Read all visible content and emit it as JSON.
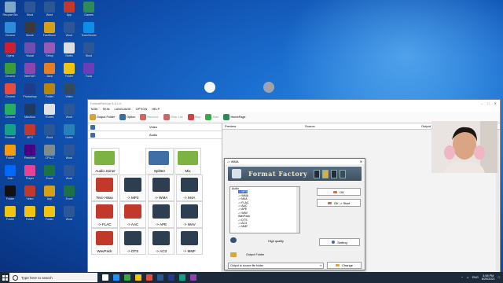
{
  "desktop_icons": [
    {
      "label": "Recycle Bin",
      "color": "#7fa7c9"
    },
    {
      "label": "Word",
      "color": "#2b5797"
    },
    {
      "label": "Word",
      "color": "#2b5797"
    },
    {
      "label": "App",
      "color": "#c0392b"
    },
    {
      "label": "Games",
      "color": "#2e8b57"
    },
    {
      "label": "Chrome",
      "color": "#2f8bd9"
    },
    {
      "label": "Movie",
      "color": "#3a3a3a"
    },
    {
      "label": "FastStone",
      "color": "#d4a017"
    },
    {
      "label": "Word",
      "color": "#2b5797"
    },
    {
      "label": "TeamViewer",
      "color": "#0e8ee9"
    },
    {
      "label": "Opera",
      "color": "#cc1f2f"
    },
    {
      "label": "Visual",
      "color": "#6e4fb0"
    },
    {
      "label": "Setup",
      "color": "#9b59b6"
    },
    {
      "label": "Notes",
      "color": "#dddddd"
    },
    {
      "label": "Word",
      "color": "#2b5797"
    },
    {
      "label": "Chrome",
      "color": "#3b9c3b"
    },
    {
      "label": "WinRAR",
      "color": "#8e44ad"
    },
    {
      "label": "Java",
      "color": "#e67e22"
    },
    {
      "label": "Folder",
      "color": "#f1c40f"
    },
    {
      "label": "Tools",
      "color": "#6a3fb5"
    },
    {
      "label": "Chrome",
      "color": "#e74c3c"
    },
    {
      "label": "Photoshop",
      "color": "#1f3c88"
    },
    {
      "label": "Folder",
      "color": "#b8860b"
    },
    {
      "label": "Video",
      "color": "#34495e"
    },
    {
      "label": "Chrome",
      "color": "#27ae60"
    },
    {
      "label": "Maxthon",
      "color": "#1f3a5f"
    },
    {
      "label": "iTunes",
      "color": "#e0e0e0"
    },
    {
      "label": "Word",
      "color": "#2b5797"
    },
    {
      "label": "Browser",
      "color": "#16a085"
    },
    {
      "label": "MP3",
      "color": "#c0392b"
    },
    {
      "label": "Word",
      "color": "#2b5797"
    },
    {
      "label": "Notes",
      "color": "#2980b9"
    },
    {
      "label": "Folder",
      "color": "#f39c12"
    },
    {
      "label": "Premiere",
      "color": "#4b0082"
    },
    {
      "label": "CPU-Z",
      "color": "#7f8c8d"
    },
    {
      "label": "Word",
      "color": "#2b5797"
    },
    {
      "label": "Zalo",
      "color": "#0068ff"
    },
    {
      "label": "Player",
      "color": "#e84393"
    },
    {
      "label": "Excel",
      "color": "#1e7145"
    },
    {
      "label": "Word",
      "color": "#2b5797"
    },
    {
      "label": "Folder",
      "color": "#111111"
    },
    {
      "label": "Video",
      "color": "#c0392b"
    },
    {
      "label": "App",
      "color": "#d4a017"
    },
    {
      "label": "Excel",
      "color": "#1e7145"
    },
    {
      "label": "Folder",
      "color": "#f1c40f"
    },
    {
      "label": "Folder",
      "color": "#f1c40f"
    },
    {
      "label": "Folder",
      "color": "#f1c40f"
    },
    {
      "label": "Word",
      "color": "#2b5797"
    }
  ],
  "floating_icons": [
    {
      "label": "",
      "color": "#f5f5f5"
    },
    {
      "label": "",
      "color": "#9aa5b0"
    }
  ],
  "ff_window": {
    "title": "FormatFactory 5.8.1.0",
    "menu": [
      "TASK",
      "SKIN",
      "LANGUAGE",
      "OPTION",
      "HELP"
    ],
    "toolbar": [
      {
        "label": "Output Folder",
        "color": "#d8a23a",
        "dim": false
      },
      {
        "label": "Option",
        "color": "#3a6ea5",
        "dim": false
      },
      {
        "label": "Remove",
        "color": "#c66",
        "dim": true
      },
      {
        "label": "Clear List",
        "color": "#c66",
        "dim": true
      },
      {
        "label": "Stop",
        "color": "#c44",
        "dim": true
      },
      {
        "label": "Start",
        "color": "#3aa845",
        "dim": true
      },
      {
        "label": "HomePage",
        "color": "#2e8b57",
        "dim": false
      }
    ],
    "categories": [
      "Video",
      "Audio"
    ],
    "tiles": [
      {
        "label": "Audio Joiner",
        "color": "#7cb342"
      },
      {
        "label": "Splitter",
        "color": "#3f6fa5"
      },
      {
        "label": "Mix",
        "color": "#7cb342"
      },
      {
        "label": "Text->Wav",
        "color": "#c0392b"
      },
      {
        "label": "-> MP3",
        "color": "#2c3e50"
      },
      {
        "label": "-> WMA",
        "color": "#2c3e50"
      },
      {
        "label": "-> M4A",
        "color": "#2c3e50"
      },
      {
        "label": "-> FLAC",
        "color": "#c0392b"
      },
      {
        "label": "-> AAC",
        "color": "#c0392b"
      },
      {
        "label": "-> APE",
        "color": "#2c3e50"
      },
      {
        "label": "-> WAV",
        "color": "#2c3e50"
      },
      {
        "label": "WavPack",
        "color": "#c0392b"
      },
      {
        "label": "-> DTS",
        "color": "#2c3e50"
      },
      {
        "label": "-> AC3",
        "color": "#2c3e50"
      },
      {
        "label": "-> MMF",
        "color": "#2c3e50"
      }
    ],
    "list_headers": {
      "preview": "Preview",
      "source": "Source",
      "output": "Output"
    }
  },
  "dialog": {
    "title": "-> WMA",
    "banner": "Format Factory",
    "tree": [
      {
        "label": "Audio",
        "sel": false
      },
      {
        "label": "-> MP3",
        "sel": true
      },
      {
        "label": "-> WMA",
        "sel": false
      },
      {
        "label": "-> M4A",
        "sel": false
      },
      {
        "label": "-> FLAC",
        "sel": false
      },
      {
        "label": "-> AAC",
        "sel": false
      },
      {
        "label": "-> APE",
        "sel": false
      },
      {
        "label": "-> WAV",
        "sel": false
      },
      {
        "label": "WavPack",
        "sel": false
      },
      {
        "label": "-> DTS",
        "sel": false
      },
      {
        "label": "-> AC3",
        "sel": false
      },
      {
        "label": "-> MMF",
        "sel": false
      }
    ],
    "ok": "OK",
    "ok_start": "OK -> Start",
    "high_quality": "High quality",
    "setting": "Setting",
    "output_folder": "Output Folder",
    "output_select": "Output to source file folder",
    "change": "Change"
  },
  "taskbar": {
    "search_placeholder": "Type here to search",
    "apps": [
      {
        "color": "#ffffff"
      },
      {
        "color": "#1e90ff"
      },
      {
        "color": "#3aa845"
      },
      {
        "color": "#f1c40f"
      },
      {
        "color": "#e74c3c"
      },
      {
        "color": "#2b5797"
      },
      {
        "color": "#1f3c88"
      },
      {
        "color": "#16a085"
      },
      {
        "color": "#8e44ad"
      }
    ],
    "lang": "ENG",
    "time": "3:58 PM",
    "date": "8/29/2021"
  }
}
